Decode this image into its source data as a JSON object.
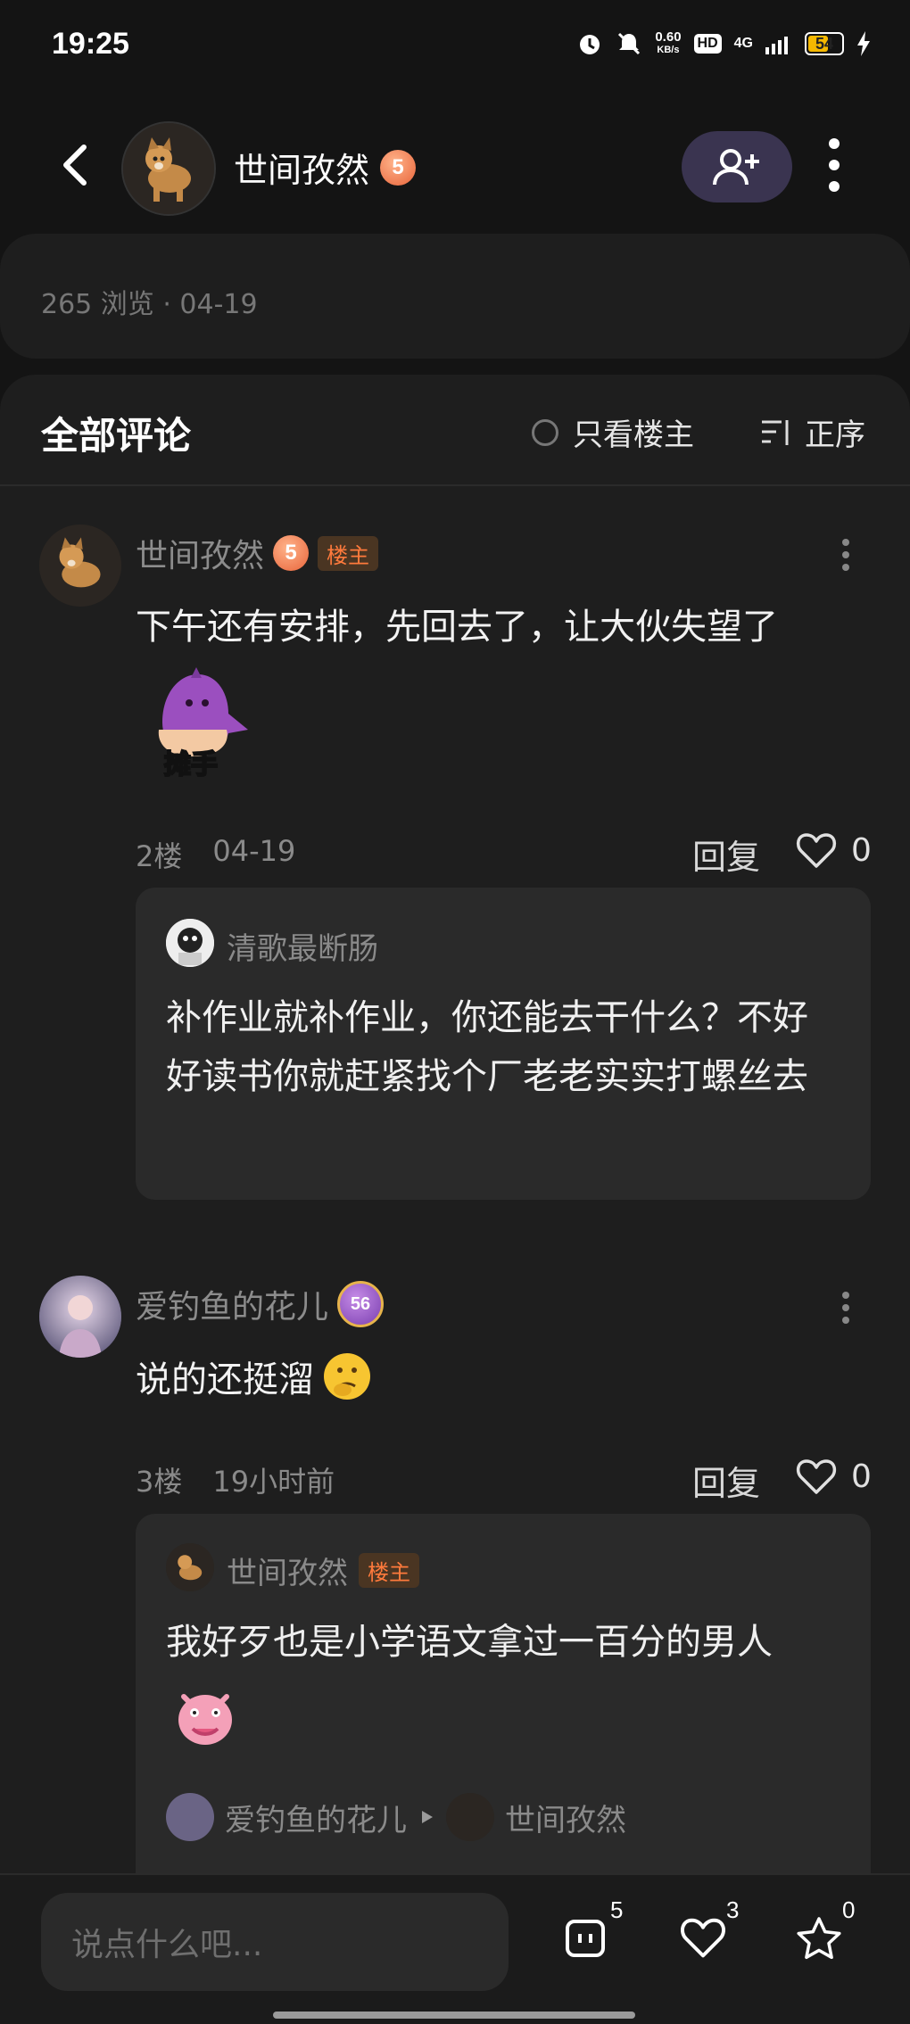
{
  "status_bar": {
    "time": "19:25",
    "speed_value": "0.60",
    "speed_unit": "KB/s",
    "hd": "HD",
    "network": "4G",
    "battery": "54"
  },
  "header": {
    "author_name": "世间孜然",
    "author_level": "5"
  },
  "post_meta": {
    "views_date": "265 浏览 · 04-19"
  },
  "comments_section": {
    "title": "全部评论",
    "only_owner_label": "只看楼主",
    "sort_label": "正序"
  },
  "comments": [
    {
      "name": "世间孜然",
      "level": "5",
      "owner_tag": "楼主",
      "text": "下午还有安排，先回去了，让大伙失望了",
      "sticker_label": "摊手",
      "floor": "2楼",
      "time": "04-19",
      "reply_label": "回复",
      "likes": "0",
      "replies": [
        {
          "name": "清歌最断肠",
          "text": "补作业就补作业，你还能去干什么？不好好读书你就赶紧找个厂老老实实打螺丝去"
        }
      ]
    },
    {
      "name": "爱钓鱼的花儿",
      "level": "56",
      "text": "说的还挺溜",
      "floor": "3楼",
      "time": "19小时前",
      "reply_label": "回复",
      "likes": "0",
      "replies": [
        {
          "name": "世间孜然",
          "owner_tag": "楼主",
          "text": "我好歹也是小学语文拿过一百分的男人"
        },
        {
          "from": "爱钓鱼的花儿",
          "to": "世间孜然"
        }
      ]
    }
  ],
  "bottom_bar": {
    "input_placeholder": "说点什么吧...",
    "comment_count": "5",
    "like_count": "3",
    "favorite_count": "0"
  },
  "colors": {
    "background": "#141414",
    "card": "#1e1e1e",
    "owner_tag": "#ff7a3c",
    "follow_button": "#3a3450"
  }
}
